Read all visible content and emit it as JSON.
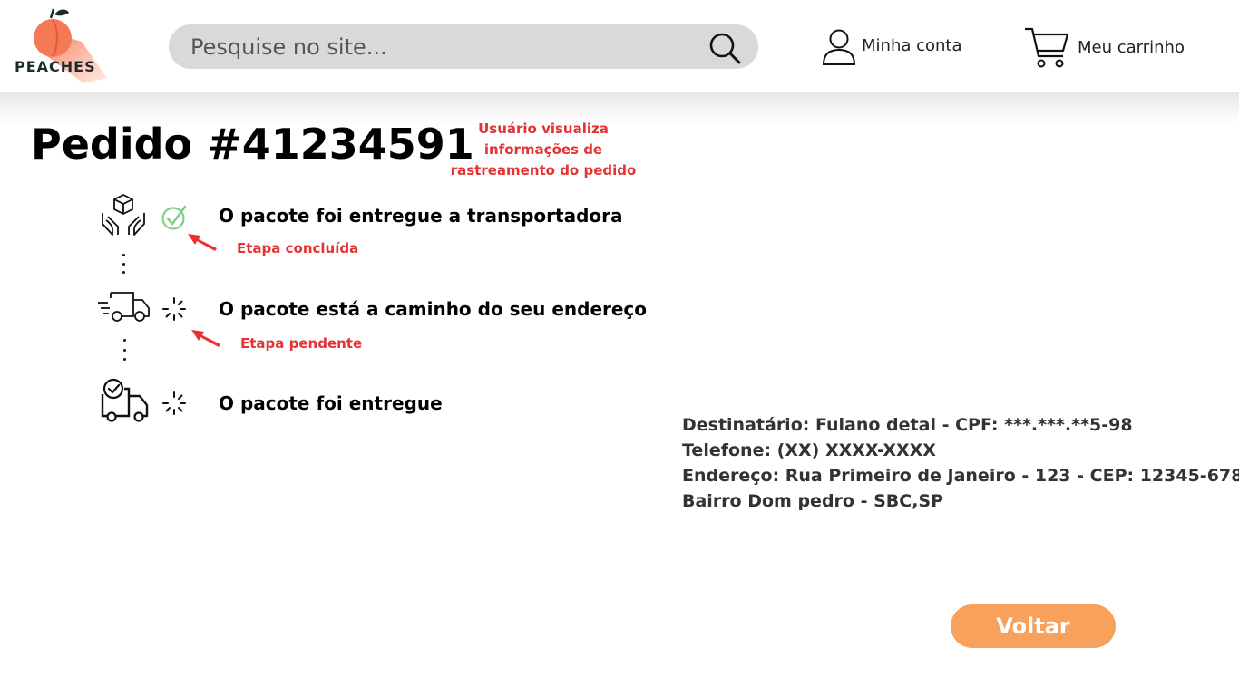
{
  "header": {
    "logo_text": "PEACHES",
    "search_placeholder": "Pesquise no site...",
    "account_label": "Minha conta",
    "cart_label": "Meu carrinho"
  },
  "order": {
    "title": "Pedido #41234591",
    "annotation": "Usuário visualiza informações de rastreamento do pedido"
  },
  "steps": [
    {
      "label": "O pacote foi entregue a transportadora",
      "icon": "package-hands-icon",
      "status": "completed",
      "status_icon": "check-circle-icon",
      "note": "Etapa concluída"
    },
    {
      "label": "O pacote está a caminho do seu endereço",
      "icon": "delivery-truck-icon",
      "status": "pending",
      "status_icon": "loading-spinner-icon",
      "note": "Etapa pendente"
    },
    {
      "label": "O pacote foi entregue",
      "icon": "delivered-truck-icon",
      "status": "pending",
      "status_icon": "loading-spinner-icon",
      "note": ""
    }
  ],
  "recipient": {
    "line1": "Destinatário: Fulano detal - CPF: ***.***.**5-98",
    "line2": "Telefone: (XX) XXXX-XXXX",
    "line3": "Endereço: Rua Primeiro de Janeiro - 123 - CEP: 12345-678",
    "line4": "Bairro Dom pedro - SBC,SP"
  },
  "actions": {
    "back_label": "Voltar"
  },
  "colors": {
    "accent": "#f7a15c",
    "annotation": "#e53232",
    "check": "#7fcf8a",
    "search_bg": "#d9d9d9"
  }
}
